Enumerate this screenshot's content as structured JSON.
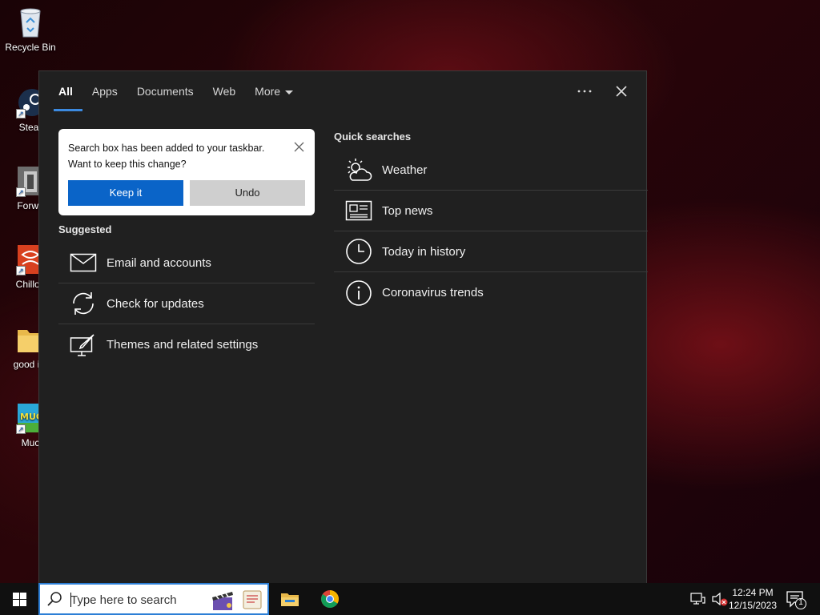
{
  "desktop": {
    "icons": [
      {
        "label": "Recycle Bin"
      },
      {
        "label": "Stear"
      },
      {
        "label": "Forwa"
      },
      {
        "label": "Chillou"
      },
      {
        "label": "good im"
      },
      {
        "label": "Muc"
      }
    ]
  },
  "search_panel": {
    "tabs": [
      {
        "label": "All"
      },
      {
        "label": "Apps"
      },
      {
        "label": "Documents"
      },
      {
        "label": "Web"
      },
      {
        "label": "More"
      }
    ],
    "more_options_icon": "ellipsis-icon",
    "close_icon": "close-icon",
    "toast": {
      "line1": "Search box has been added to your taskbar.",
      "line2": "Want to keep this change?",
      "keep_label": "Keep it",
      "undo_label": "Undo"
    },
    "suggested": {
      "title": "Suggested",
      "items": [
        {
          "label": "Email and accounts",
          "icon": "mail-icon"
        },
        {
          "label": "Check for updates",
          "icon": "sync-icon"
        },
        {
          "label": "Themes and related settings",
          "icon": "paint-monitor-icon"
        }
      ]
    },
    "quick_searches": {
      "title": "Quick searches",
      "items": [
        {
          "label": "Weather",
          "icon": "weather-icon"
        },
        {
          "label": "Top news",
          "icon": "news-icon"
        },
        {
          "label": "Today in history",
          "icon": "clock-icon"
        },
        {
          "label": "Coronavirus trends",
          "icon": "info-icon"
        }
      ]
    }
  },
  "taskbar": {
    "search_placeholder": "Type here to search",
    "clock_time": "12:24 PM",
    "clock_date": "12/15/2023",
    "notification_count": "1"
  },
  "colors": {
    "accent": "#0a64c8",
    "tab_underline": "#3c8ae0",
    "panel_bg": "#202020",
    "taskbar_bg": "#101010"
  }
}
